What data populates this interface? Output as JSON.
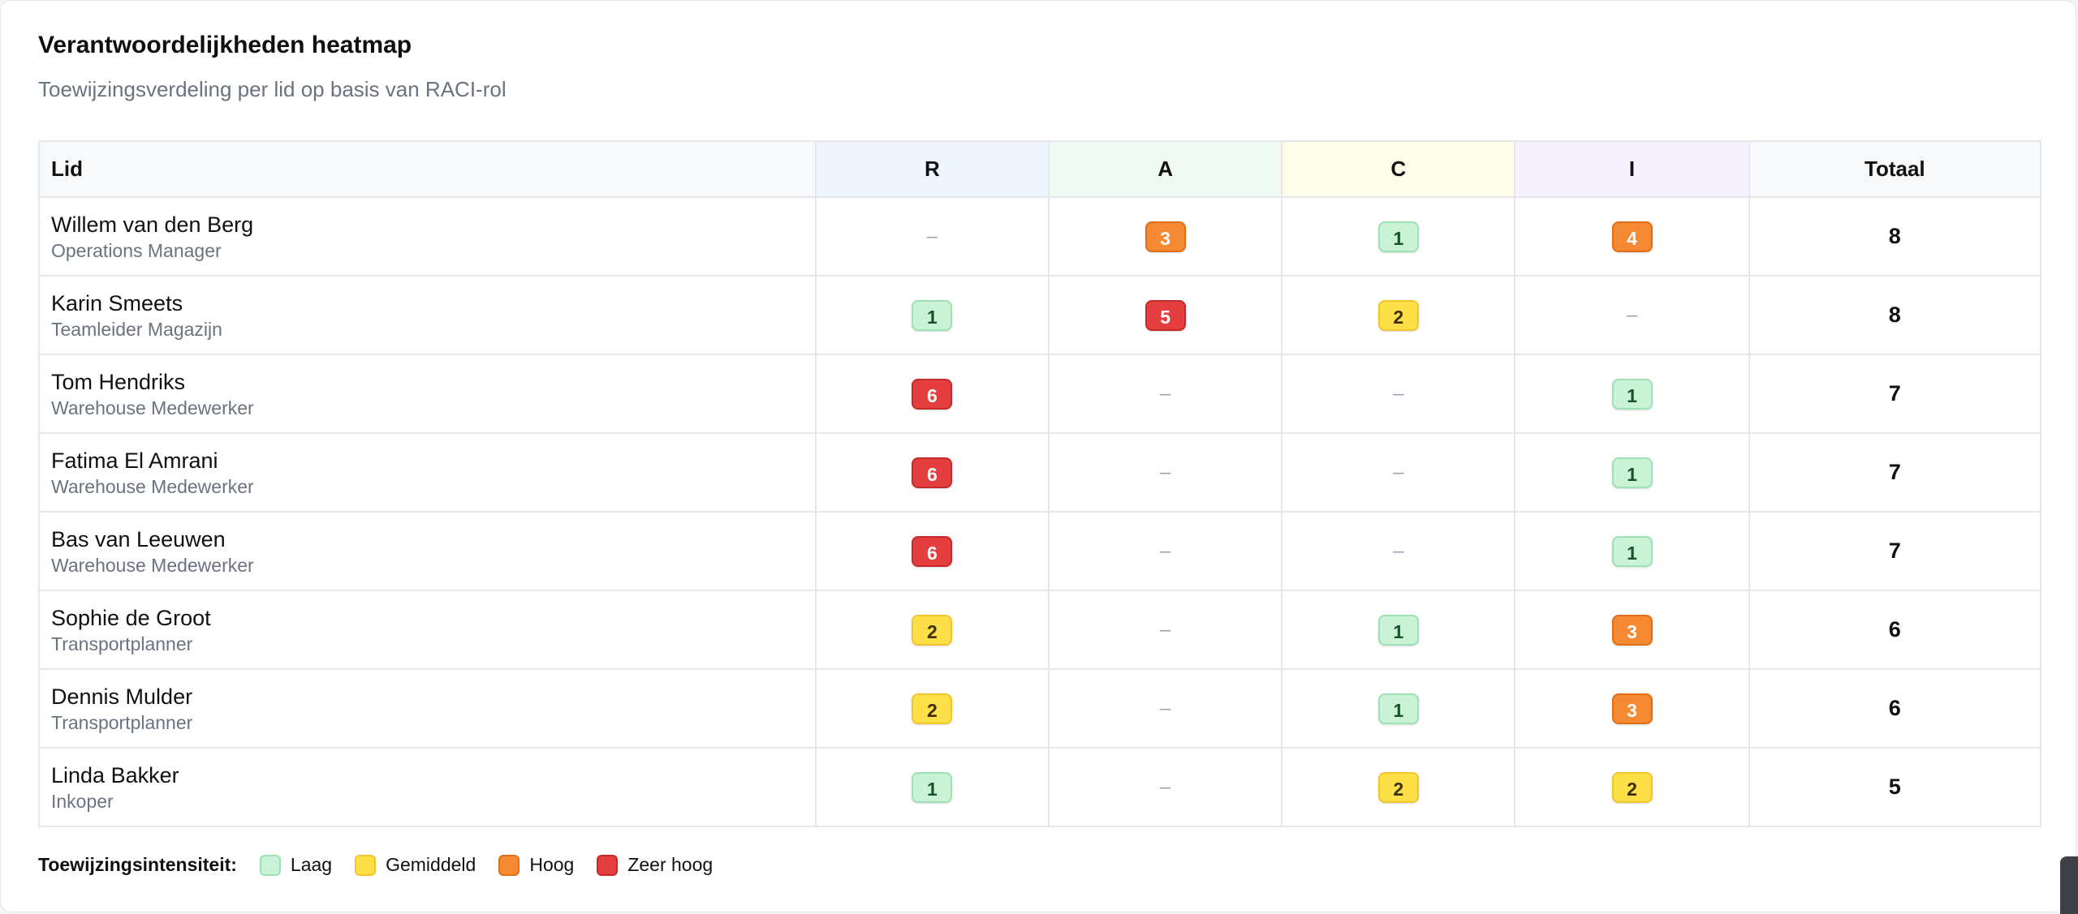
{
  "card": {
    "title": "Verantwoordelijkheden heatmap",
    "subtitle": "Toewijzingsverdeling per lid op basis van RACI-rol"
  },
  "table": {
    "headers": [
      "Lid",
      "R",
      "A",
      "C",
      "I",
      "Totaal"
    ],
    "header_colors": {
      "R": "#eef5fe",
      "A": "#effaf2",
      "C": "#fefdea",
      "I": "#f6f3fe"
    },
    "empty_marker": "–",
    "rows": [
      {
        "name": "Willem van den Berg",
        "role": "Operations Manager",
        "r": "",
        "a": "3",
        "c": "1",
        "i": "4",
        "total": "8"
      },
      {
        "name": "Karin Smeets",
        "role": "Teamleider Magazijn",
        "r": "1",
        "a": "5",
        "c": "2",
        "i": "",
        "total": "8"
      },
      {
        "name": "Tom Hendriks",
        "role": "Warehouse Medewerker",
        "r": "6",
        "a": "",
        "c": "",
        "i": "1",
        "total": "7"
      },
      {
        "name": "Fatima El Amrani",
        "role": "Warehouse Medewerker",
        "r": "6",
        "a": "",
        "c": "",
        "i": "1",
        "total": "7"
      },
      {
        "name": "Bas van Leeuwen",
        "role": "Warehouse Medewerker",
        "r": "6",
        "a": "",
        "c": "",
        "i": "1",
        "total": "7"
      },
      {
        "name": "Sophie de Groot",
        "role": "Transportplanner",
        "r": "2",
        "a": "",
        "c": "1",
        "i": "3",
        "total": "6"
      },
      {
        "name": "Dennis Mulder",
        "role": "Transportplanner",
        "r": "2",
        "a": "",
        "c": "1",
        "i": "3",
        "total": "6"
      },
      {
        "name": "Linda Bakker",
        "role": "Inkoper",
        "r": "1",
        "a": "",
        "c": "2",
        "i": "2",
        "total": "5"
      }
    ]
  },
  "legend": {
    "label": "Toewijzingsintensiteit:",
    "items": [
      {
        "label": "Laag",
        "color": "#c9f2d6"
      },
      {
        "label": "Gemiddeld",
        "color": "#fde047"
      },
      {
        "label": "Hoog",
        "color": "#f58a32"
      },
      {
        "label": "Zeer hoog",
        "color": "#e53e3e"
      }
    ]
  }
}
